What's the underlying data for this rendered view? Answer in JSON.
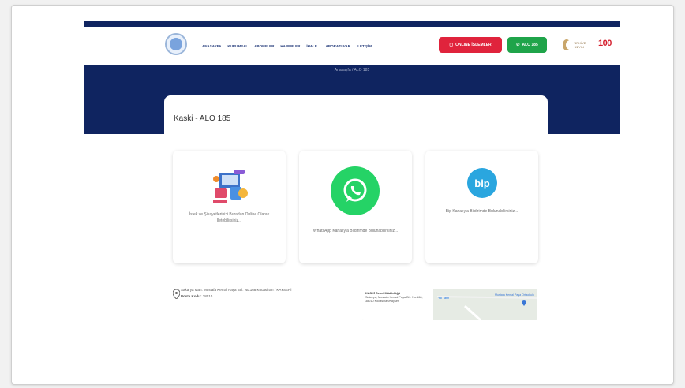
{
  "nav": {
    "items": [
      "ANASAYFA",
      "KURUMSAL",
      "ABONELER",
      "HABERLER",
      "İHALE",
      "LABORATUVAR",
      "İLETİŞİM"
    ]
  },
  "buttons": {
    "online_label": "ONLINE İŞLEMLER",
    "alo_label": "ALO 185"
  },
  "centennial": "100",
  "tr_text": "TÜRKİYE YÜZYILI",
  "breadcrumb": "Anasayfa  /  ALO 185",
  "page_title": "Kaski - ALO 185",
  "tiles": [
    {
      "text": "İstek ve Şikayetlerinizi Buradan Online Olarak İletebilirsiniz..."
    },
    {
      "text": "WhatsApp Kanalıyla Bildirimde Bulunabilirsiniz..."
    },
    {
      "text": "Bip Kanalıyla Bildirimde Bulunabilirsiniz..."
    }
  ],
  "bip_label": "bip",
  "address": {
    "line": "Sakarya Mah. Mustafa Kemal Paşa Bul. No:168 Kocasinan / KAYSERİ",
    "postal_label": "Posta Kodu:",
    "postal_code": "38010"
  },
  "map": {
    "name": "KASKİ Genel Müdürlüğü",
    "addr": "Sakarya, Mustafa Kemal Paşa Blv. No:168, 38010 Kocasinan/Kayseri",
    "directions": "Yol Tarifi",
    "poi": "Mustafa Kemal Paşa Ortaokulu"
  },
  "colors": {
    "navy": "#0f2460",
    "red": "#e0233c",
    "green": "#1fa44a",
    "whatsapp": "#25d366",
    "bip": "#2aa6df"
  }
}
